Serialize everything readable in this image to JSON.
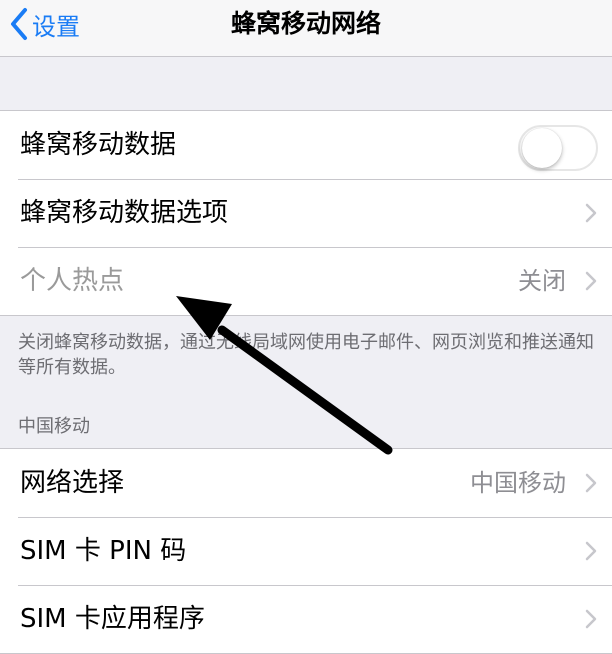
{
  "navbar": {
    "back_label": "设置",
    "title": "蜂窝移动网络"
  },
  "group1": {
    "rows": [
      {
        "label": "蜂窝移动数据",
        "control": "toggle",
        "toggle_on": false
      },
      {
        "label": "蜂窝移动数据选项",
        "control": "chevron-right-icon"
      },
      {
        "label": "个人热点",
        "value": "关闭",
        "control": "chevron-right-icon"
      }
    ],
    "footnote": "关闭蜂窝移动数据，通过无线局域网使用电子邮件、网页浏览和推送通知等所有数据。"
  },
  "section2": {
    "header": "中国移动",
    "rows": [
      {
        "label": "网络选择",
        "value": "中国移动",
        "control": "chevron-right-icon"
      },
      {
        "label": "SIM 卡 PIN 码",
        "control": "chevron-right-icon"
      },
      {
        "label": "SIM 卡应用程序",
        "control": "chevron-right-icon"
      }
    ]
  },
  "colors": {
    "accent": "#1a7cf5",
    "background": "#efeff4",
    "secondary_text": "#8e8e93",
    "annotation_arrow": "#000000"
  }
}
